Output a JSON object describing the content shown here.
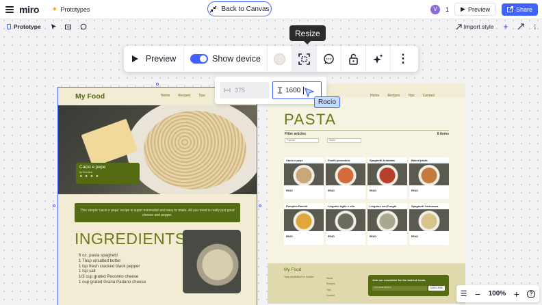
{
  "app": {
    "logo": "miro",
    "board_link": "Prototypes"
  },
  "header": {
    "back_label": "Back to Canvas",
    "avatar_initial": "V",
    "user_count": "1",
    "preview_label": "Preview",
    "share_label": "Share"
  },
  "toolbar": {
    "tab_label": "Prototype",
    "import_label": "Import style"
  },
  "floating_toolbar": {
    "preview_label": "Preview",
    "show_device_label": "Show device",
    "show_device_on": true,
    "tooltip": "Resize"
  },
  "resize": {
    "width_value": "375",
    "height_value": "1600"
  },
  "collaborator": {
    "name": "Rocío"
  },
  "mobile": {
    "brand": "My Food",
    "nav": [
      "Home",
      "Recipes",
      "Tips"
    ],
    "hero_title": "Cacio e pepe",
    "hero_by": "by Riva Bud",
    "hero_stars": "★ ★ ★ ★",
    "description": "This simple 'cacio e pepe' recipe is super minimalist and easy to make. All you need is really just good cheese and pepper.",
    "ingredients_title": "INGREDIENTS",
    "ingredients": [
      "6 oz. pasta spaghetti",
      "1 Tbsp unsalted butter",
      "1 tsp fresh cracked black pepper",
      "1 tsp salt",
      "1/3 cup grated Pecorino cheese",
      "1 cup grated Grana Padano cheese"
    ]
  },
  "desktop": {
    "nav": [
      "Home",
      "Recipes",
      "Tips",
      "Contact"
    ],
    "title": "PASTA",
    "filter_label": "Filter articles",
    "items_count": "8 items",
    "selects": [
      "Popular",
      "Italian"
    ],
    "read_label": "READ",
    "cards": [
      {
        "title": "Cacio e pepe",
        "color": "#c8a878"
      },
      {
        "title": "Fusilli pomodoro",
        "color": "#d46a3a"
      },
      {
        "title": "Spaghetti Arrabiata",
        "color": "#b8402a"
      },
      {
        "title": "Baked pasta",
        "color": "#c47a3e"
      },
      {
        "title": "Pumpkin Ravioli",
        "color": "#e0a83a"
      },
      {
        "title": "Linguine Aglio e olio",
        "color": "#6b6b5e"
      },
      {
        "title": "Linguine con Funghi",
        "color": "#a8a890"
      },
      {
        "title": "Spaghetti Carbonara",
        "color": "#d8c48a"
      }
    ],
    "footer_brand": "My Food",
    "footer_tagline": "Tasty destination for foodies",
    "footer_links": [
      "Home",
      "Recipes",
      "Tips",
      "Contact"
    ],
    "newsletter_title": "Join our newsletter for the tastiest treats.",
    "newsletter_placeholder": "Your email address",
    "subscribe_label": "SUBSCRIBE"
  },
  "zoom": {
    "level": "100%"
  },
  "colors": {
    "accent": "#4262ff",
    "olive": "#556b12",
    "cream": "#f1ecd3"
  }
}
